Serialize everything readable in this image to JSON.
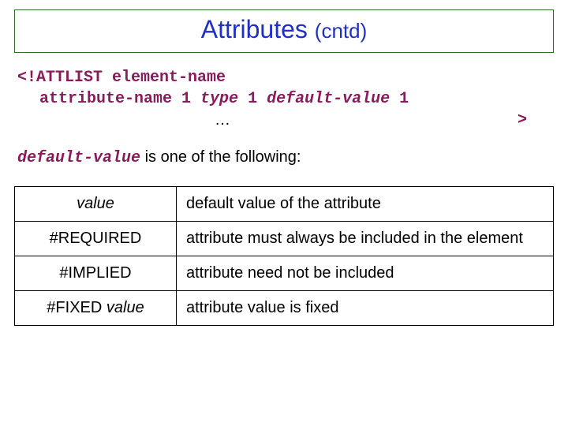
{
  "title": {
    "main": "Attributes ",
    "paren": "(cntd)"
  },
  "code": {
    "line1": "<!ATTLIST element-name",
    "line2_plain": "attribute-name 1 ",
    "line2_italic1": "type",
    "line2_mid": " 1 ",
    "line2_italic2": "default-value",
    "line2_tail": " 1",
    "ellipsis": "…",
    "gt": ">"
  },
  "desc": {
    "mono": "default-value",
    "rest": " is one of the following:"
  },
  "table": {
    "rows": [
      {
        "k_italic": "value",
        "k_prefix": "",
        "v": "default value of the attribute"
      },
      {
        "k_italic": "",
        "k_prefix": "#REQUIRED",
        "v": "attribute must always be included in the element"
      },
      {
        "k_italic": "",
        "k_prefix": "#IMPLIED",
        "v": "attribute need not be included"
      },
      {
        "k_italic": "value",
        "k_prefix": "#FIXED ",
        "v": "attribute value is fixed"
      }
    ]
  }
}
